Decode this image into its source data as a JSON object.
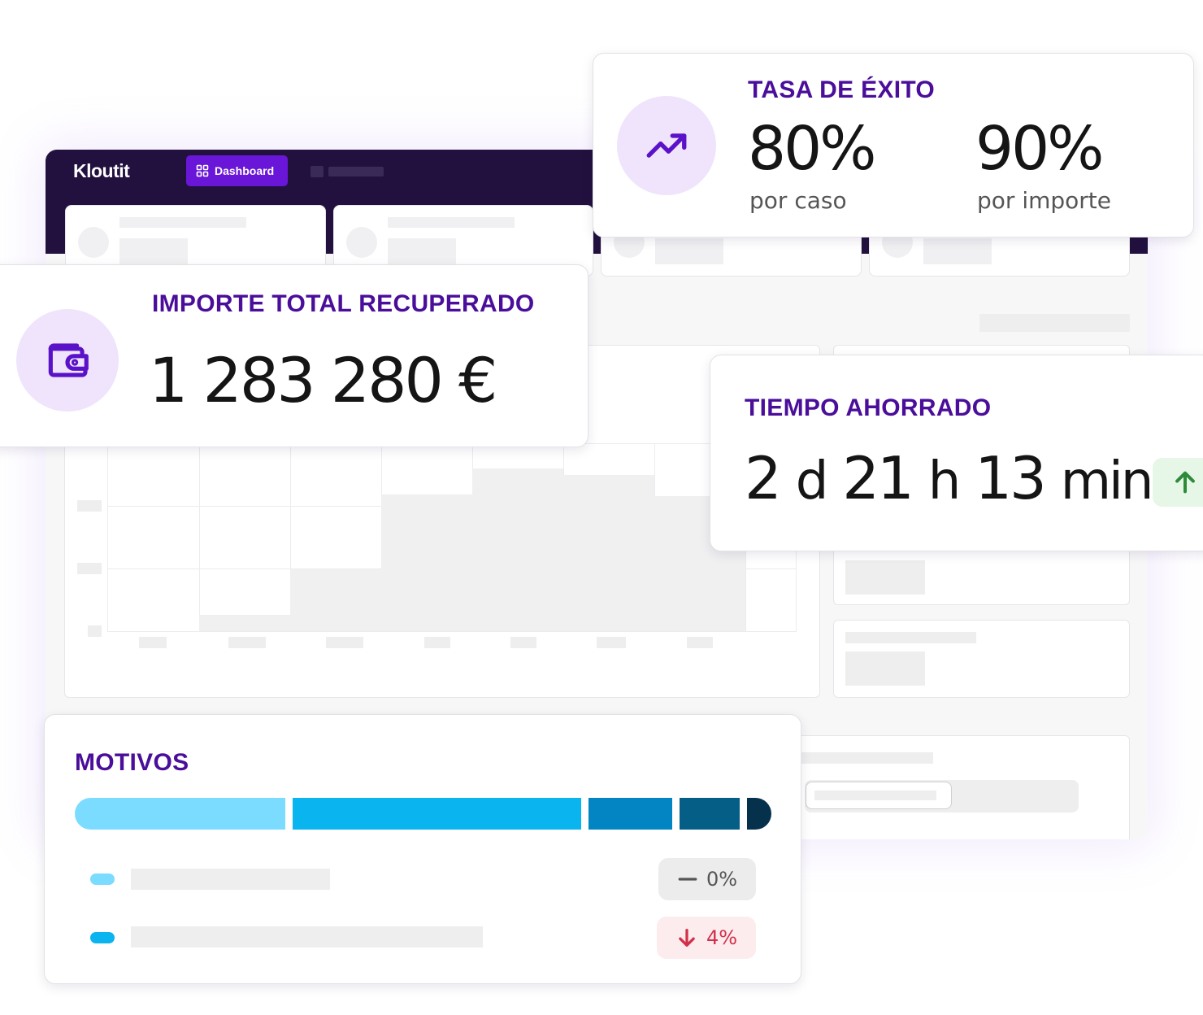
{
  "app": {
    "brand": "Kloutit",
    "nav": {
      "dashboard_label": "Dashboard"
    }
  },
  "success_rate": {
    "title": "TASA DE ÉXITO",
    "icon": "trending-up-icon",
    "by_case_value": "80%",
    "by_case_label": "por caso",
    "by_amount_value": "90%",
    "by_amount_label": "por importe"
  },
  "total_recovered": {
    "title": "IMPORTE TOTAL RECUPERADO",
    "icon": "wallet-icon",
    "value": "1 283 280 €"
  },
  "time_saved": {
    "title": "TIEMPO AHORRADO",
    "days_num": "2",
    "days_unit": "d",
    "hours_num": "21",
    "hours_unit": "h",
    "minutes_num": "13",
    "minutes_unit": "min",
    "trend_icon": "arrow-up-icon"
  },
  "reasons": {
    "title": "MOTIVOS",
    "segments": [
      {
        "share": 0.3,
        "color": "#7bdcff"
      },
      {
        "share": 0.41,
        "color": "#0ab4ef"
      },
      {
        "share": 0.12,
        "color": "#0285c2"
      },
      {
        "share": 0.085,
        "color": "#045e86"
      },
      {
        "share": 0.035,
        "color": "#06314c"
      }
    ],
    "rows": [
      {
        "color": "#7bdcff",
        "change": "0%",
        "trend_icon": "minus-icon"
      },
      {
        "color": "#0ab4ef",
        "change": "4%",
        "trend_icon": "arrow-down-icon"
      }
    ]
  },
  "colors": {
    "brand_dark": "#22113f",
    "accent_purple": "#6a16d8",
    "title_purple": "#4a0e9a",
    "icon_bg": "#efe4fc",
    "positive": "#2e8b3a",
    "negative": "#d2304a"
  }
}
